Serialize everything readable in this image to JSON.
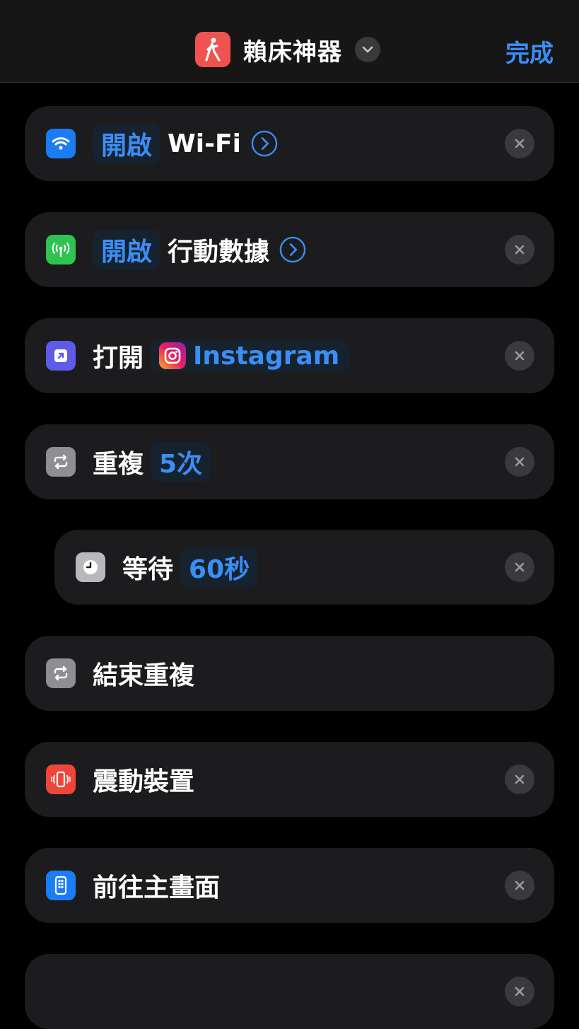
{
  "header": {
    "title": "賴床神器",
    "done_label": "完成",
    "app_icon": "person-walking-icon",
    "accent_color": "#3a8ef6"
  },
  "actions": [
    {
      "icon": "wifi-icon",
      "icon_color": "#1b7cf6",
      "token": "開啟",
      "text": "Wi-Fi",
      "has_arrow": true
    },
    {
      "icon": "cellular-antenna-icon",
      "icon_color": "#30c351",
      "token": "開啟",
      "text": "行動數據",
      "has_arrow": true
    },
    {
      "icon": "open-app-icon",
      "icon_color": "#5e5ce6",
      "text": "打開",
      "app_token": "Instagram"
    },
    {
      "icon": "repeat-icon",
      "icon_color": "#8e8e93",
      "text": "重複",
      "token": "5次"
    },
    {
      "icon": "clock-icon",
      "icon_color": "#b8b8bd",
      "text": "等待",
      "token": "60秒",
      "indented": true
    },
    {
      "icon": "repeat-icon",
      "icon_color": "#8e8e93",
      "text": "結束重複"
    },
    {
      "icon": "vibrate-phone-icon",
      "icon_color": "#f0453a",
      "text": "震動裝置"
    },
    {
      "icon": "home-screen-icon",
      "icon_color": "#1b7cf6",
      "text": "前往主畫面"
    }
  ]
}
